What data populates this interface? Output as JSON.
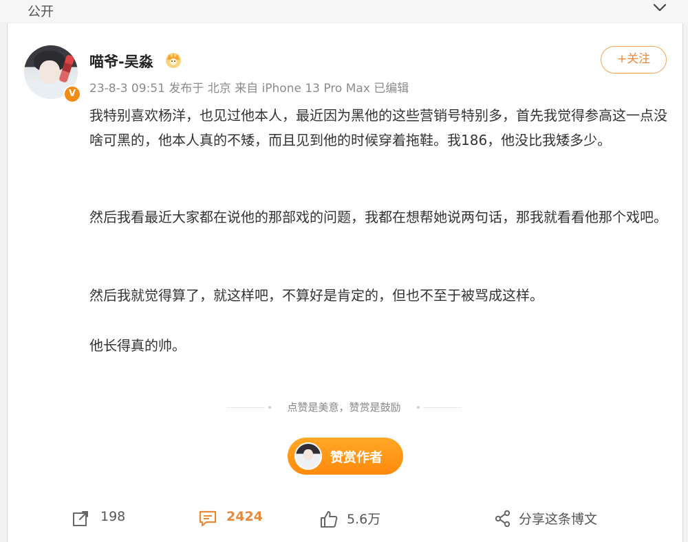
{
  "topbar": {
    "visibility": "公开",
    "collapse_icon": "chevron-down-icon"
  },
  "author": {
    "name": "喵爷-吴淼",
    "badge_icon": "crown-icon",
    "verified_icon": "verified-v-icon",
    "verified_letter": "V"
  },
  "meta": "23-8-3 09:51 发布于 北京 来自 iPhone 13 Pro Max 已编辑",
  "follow_label": "+关注",
  "post": {
    "paragraphs": [
      "我特别喜欢杨洋，也见过他本人，最近因为黑他的这些营销号特别多，首先我觉得参高这一点没啥可黑的，他本人真的不矮，而且见到他的时候穿着拖鞋。我186，他没比我矮多少。",
      "然后我看最近大家都在说他的那部戏的问题，我都在想帮她说两句话，那我就看看他那个戏吧。",
      "然后我就觉得算了，就这样吧，不算好是肯定的，但也不至于被骂成这样。",
      "他长得真的帅。"
    ]
  },
  "divider_text": "点赞是美意，赞赏是鼓励",
  "reward_label": "赞赏作者",
  "actions": {
    "repost_count": "198",
    "comment_count": "2424",
    "like_count": "5.6万",
    "share_label": "分享这条博文"
  },
  "colors": {
    "accent": "#ff8a0c",
    "follow": "#e8893a",
    "meta": "#8b8b8b"
  }
}
